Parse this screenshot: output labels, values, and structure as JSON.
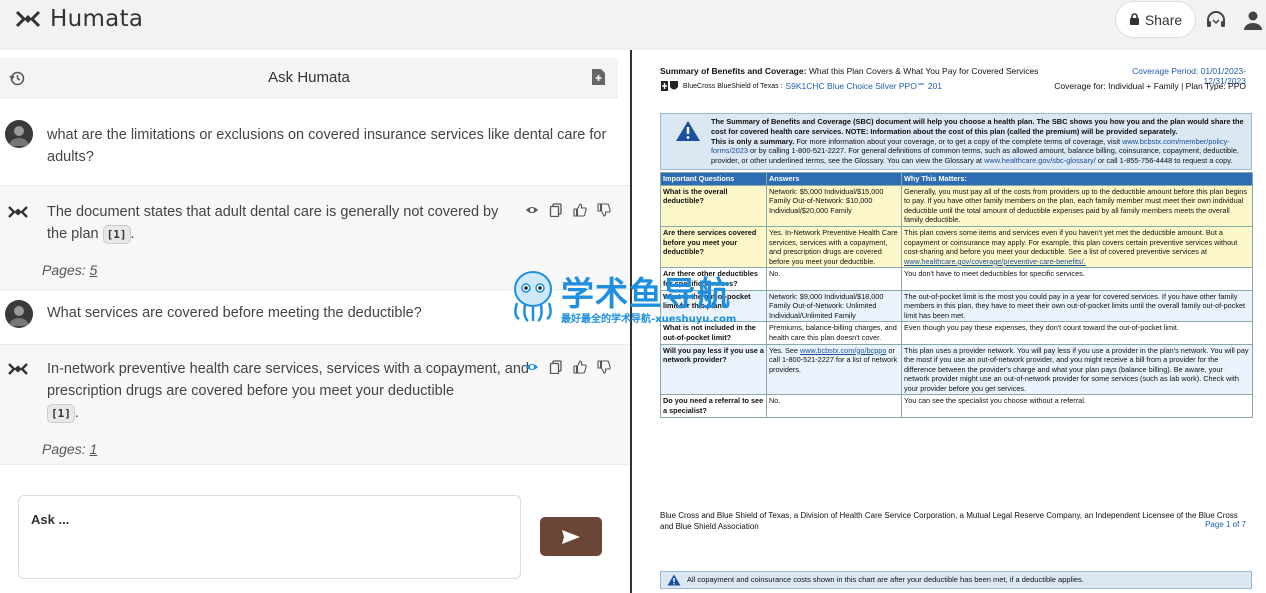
{
  "app": {
    "name": "Humata"
  },
  "topbar": {
    "share_label": "Share"
  },
  "chat": {
    "header_title": "Ask Humata",
    "messages": [
      {
        "role": "user",
        "text": "what are the limitations or exclusions on covered insurance services like dental care for adults?"
      },
      {
        "role": "ai",
        "text": "The document states that adult dental care is generally not covered by the plan",
        "citation": "[1]",
        "pages_label": "Pages:",
        "pages_value": "5"
      },
      {
        "role": "user",
        "text": "What services are covered before meeting the deductible?"
      },
      {
        "role": "ai",
        "text": "In-network preventive health care services, services with a copayment, and prescription drugs are covered before you meet your deductible",
        "citation": "[1]",
        "pages_label": "Pages:",
        "pages_value": "1"
      }
    ],
    "input_placeholder": "Ask ..."
  },
  "document": {
    "title_prefix": "Summary of Benefits and Coverage:",
    "title_rest": "What this Plan Covers & What You Pay for Covered Services",
    "coverage_period": "Coverage Period: 01/01/2023-12/31/2023",
    "issuer": "BlueCross BlueShield of Texas :",
    "plan_name": "S9K1CHC Blue Choice Silver PPO℠ 201",
    "coverage_for": "Coverage for: Individual + Family | Plan Type: PPO",
    "intro_bold": "The Summary of Benefits and Coverage (SBC) document will help you choose a health plan. The SBC shows you how you and the plan would share the cost for covered health care services. NOTE: Information about the cost of this plan (called the premium) will be provided separately.",
    "intro_summary_bold": "This is only a summary.",
    "intro_rest1": "For more information about your coverage, or to get a copy of the complete terms of coverage, visit",
    "intro_link1": "www.bcbstx.com/member/policy-forms/2023",
    "intro_rest2": "or by calling 1-800-521-2227. For general definitions of common terms, such as allowed amount, balance billing, coinsurance, copayment, deductible, provider, or other underlined terms, see the Glossary. You can view the Glossary at",
    "intro_link2": "www.healthcare.gov/sbc-glossary/",
    "intro_rest3": "or call 1-855-756-4448 to request a copy.",
    "table_headers": [
      "Important Questions",
      "Answers",
      "Why This Matters:"
    ],
    "rows": [
      {
        "q": "What is the overall deductible?",
        "a": "Network: $5,000 Individual/$15,000 Family Out-of-Network: $10,000 Individual/$20,000 Family",
        "w": "Generally, you must pay all of the costs from providers up to the deductible amount before this plan begins to pay. If you have other family members on the plan, each family member must meet their own individual deductible until the total amount of deductible expenses paid by all family members meets the overall family deductible."
      },
      {
        "q": "Are there services covered before you meet your deductible?",
        "a": "Yes. In-Network Preventive Health Care services, services with a copayment, and prescription drugs are covered before you meet your deductible.",
        "w": "This plan covers some items and services even if you haven't yet met the deductible amount. But a copayment or coinsurance may apply. For example, this plan covers certain preventive services without cost-sharing and before you meet your deductible. See a list of covered preventive services at",
        "w_link": "www.healthcare.gov/coverage/preventive-care-benefits/."
      },
      {
        "q": "Are there other deductibles for specific services?",
        "a": "No.",
        "w": "You don't have to meet deductibles for specific services."
      },
      {
        "q": "What is the out-of-pocket limit for this plan?",
        "a": "Network: $9,000 Individual/$18,000 Family Out-of-Network: Unlimited Individual/Unlimited Family",
        "w": "The out-of-pocket limit is the most you could pay in a year for covered services. If you have other family members in this plan, they have to meet their own out-of-pocket limits until the overall family out-of-pocket limit has been met."
      },
      {
        "q": "What is not included in the out-of-pocket limit?",
        "a": "Premiums, balance-billing charges, and health care this plan doesn't cover.",
        "w": "Even though you pay these expenses, they don't count toward the out-of-pocket limit."
      },
      {
        "q": "Will you pay less if you use a network provider?",
        "a_prefix": "Yes. See",
        "a_link": "www.bcbstx.com/go/bcppo",
        "a": "or call 1-800-521-2227 for a list of network providers.",
        "w": "This plan uses a provider network. You will pay less if you use a provider in the plan's network. You will pay the most if you use an out-of-network provider, and you might receive a bill from a provider for the difference between the provider's charge and what your plan pays (balance billing). Be aware, your network provider might use an out-of-network provider for some services (such as lab work). Check with your provider before you get services."
      },
      {
        "q": "Do you need a referral to see a specialist?",
        "a": "No.",
        "w": "You can see the specialist you choose without a referral."
      }
    ],
    "footer": "Blue Cross and Blue Shield of Texas, a Division of Health Care Service Corporation, a Mutual Legal Reserve Company, an Independent Licensee of the Blue Cross and Blue Shield Association",
    "page_label": "Page 1 of 7",
    "note": "All copayment and coinsurance costs shown in this chart are after your deductible has been met, if a deductible applies."
  },
  "watermark": {
    "title": "学术鱼导航",
    "subtitle": "最好最全的学术导航-xueshuyu.com"
  },
  "colors": {
    "accent": "#6b4535",
    "doc_blue": "#2e6db4",
    "highlight": "#fbf7c9"
  }
}
